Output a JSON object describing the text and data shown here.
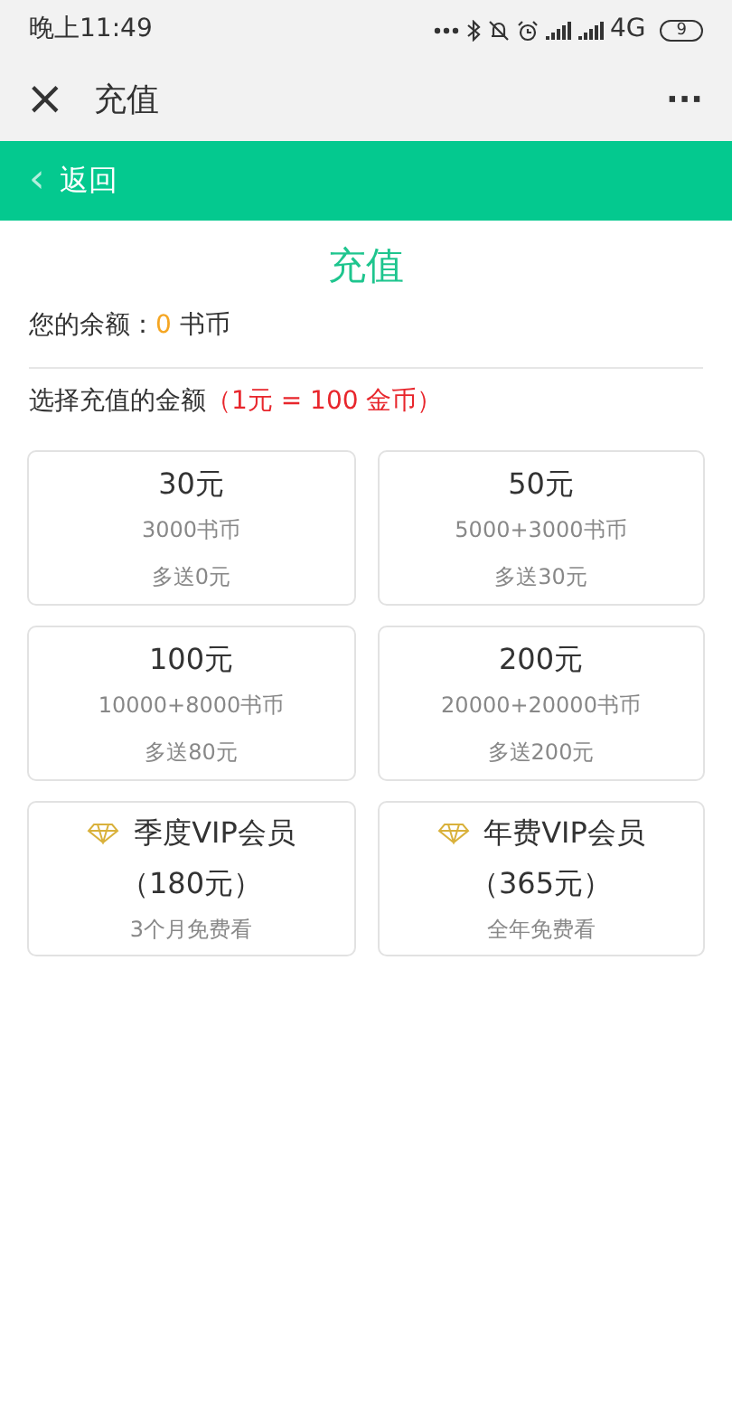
{
  "status_bar": {
    "time": "晚上11:49",
    "network": "4G",
    "battery": "9"
  },
  "title_bar": {
    "close": "×",
    "title": "充值",
    "more": "···"
  },
  "nav_bar": {
    "back_icon": "‹",
    "back": "返回"
  },
  "heading": "充值",
  "balance": {
    "label": "您的余额：",
    "amount": "0",
    "unit": "书币"
  },
  "choose": {
    "label": "选择充值的金额",
    "rate": "（1元 = 100 金币）"
  },
  "options": [
    {
      "kind": "amount",
      "price": "30元",
      "coins": "3000书币",
      "bonus": "多送0元"
    },
    {
      "kind": "amount",
      "price": "50元",
      "coins": "5000+3000书币",
      "bonus": "多送30元"
    },
    {
      "kind": "amount",
      "price": "100元",
      "coins": "10000+8000书币",
      "bonus": "多送80元"
    },
    {
      "kind": "amount",
      "price": "200元",
      "coins": "20000+20000书币",
      "bonus": "多送200元"
    },
    {
      "kind": "vip",
      "title": "季度VIP会员",
      "price": "（180元）",
      "note": "3个月免费看"
    },
    {
      "kind": "vip",
      "title": "年费VIP会员",
      "price": "（365元）",
      "note": "全年免费看"
    }
  ]
}
